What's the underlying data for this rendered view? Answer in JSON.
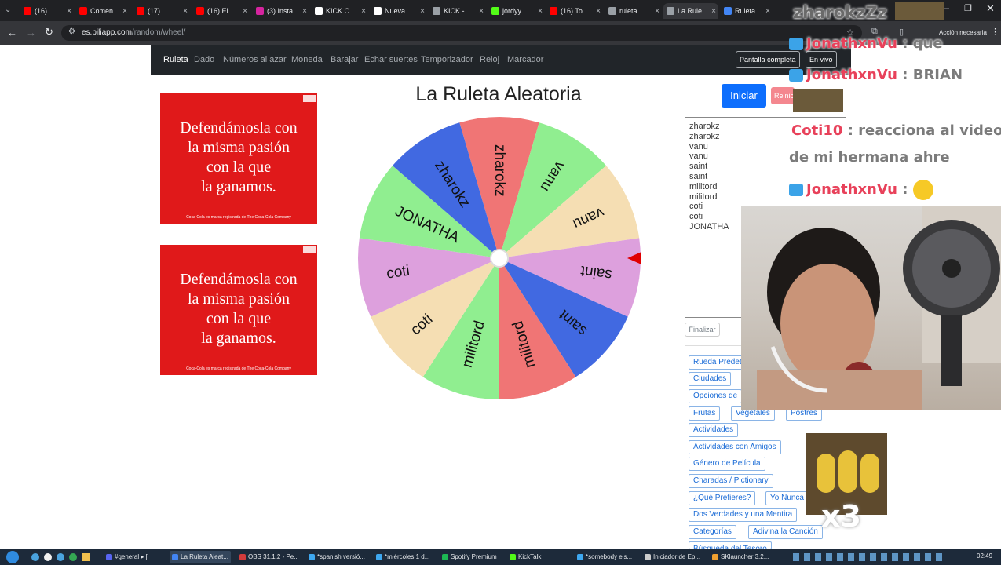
{
  "browser": {
    "tabs": [
      {
        "label": "(16)",
        "color": "#ff0000"
      },
      {
        "label": "Comen",
        "color": "#ff0000"
      },
      {
        "label": "(17)",
        "color": "#ff0000"
      },
      {
        "label": "(16) El",
        "color": "#ff0000"
      },
      {
        "label": "(3) Insta",
        "color": "#d6249f"
      },
      {
        "label": "KICK C",
        "color": "#ffffff"
      },
      {
        "label": "Nueva",
        "color": "#ffffff"
      },
      {
        "label": "KICK -",
        "color": "#9aa0a6"
      },
      {
        "label": "jordyy",
        "color": "#53fc18"
      },
      {
        "label": "(16) To",
        "color": "#ff0000"
      },
      {
        "label": "ruleta",
        "color": "#9aa0a6"
      },
      {
        "label": "La Rule",
        "color": "#9aa0a6"
      },
      {
        "label": "Ruleta",
        "color": "#4285f4"
      }
    ],
    "url_domain": "es.piliapp.com",
    "url_path": "/random/wheel/",
    "account_label": "Acción necesaria"
  },
  "nav": {
    "links": [
      "Ruleta",
      "Dado",
      "Números al azar",
      "Moneda",
      "Barajar",
      "Echar suertes",
      "Temporizador",
      "Reloj",
      "Marcador"
    ],
    "fullscreen_label": "Pantalla completa",
    "live_label": "En vivo"
  },
  "ads": {
    "text_line1": "Defendámosla con",
    "text_line2": "la misma pasión",
    "text_line3": "con la que",
    "text_line4": "la ganamos.",
    "footer": "Coca-Cola es marca registrada de The Coca-Cola Company"
  },
  "wheel": {
    "title": "La Ruleta Aleatoria",
    "start_label": "Iniciar",
    "reset_label": "Reinic",
    "finish_label": "Finalizar",
    "entries": [
      "zharokz",
      "zharokz",
      "vanu",
      "vanu",
      "saint",
      "saint",
      "militord",
      "militord",
      "coti",
      "coti",
      "JONATHA"
    ],
    "segments": [
      {
        "label": "zharokz",
        "color": "#f07575"
      },
      {
        "label": "vanu",
        "color": "#90ee90"
      },
      {
        "label": "vanu",
        "color": "#f5deb3"
      },
      {
        "label": "saint",
        "color": "#dda0dd"
      },
      {
        "label": "saint",
        "color": "#4169e1"
      },
      {
        "label": "militord",
        "color": "#f07575"
      },
      {
        "label": "militord",
        "color": "#90ee90"
      },
      {
        "label": "coti",
        "color": "#f5deb3"
      },
      {
        "label": "coti",
        "color": "#dda0dd"
      },
      {
        "label": "JONATHA",
        "color": "#90ee90"
      },
      {
        "label": "zharokz",
        "color": "#4169e1"
      }
    ],
    "pointer_color": "#e00000"
  },
  "presets": {
    "default_label": "Rueda Predet",
    "cities": "Ciudades",
    "options": "Opciones de",
    "fruits": "Frutas",
    "vegetables": "Vegetales",
    "desserts": "Postres",
    "activities": "Actividades",
    "activities_friends": "Actividades con Amigos",
    "movie_genre": "Género de Película",
    "charades": "Charadas / Pictionary",
    "would_you_rather": "¿Qué Prefieres?",
    "never": "Yo Nunca",
    "two_truths": "Dos Verdades y una Mentira",
    "categories": "Categorías",
    "guess_song": "Adivina la Canción",
    "hunt": "Búsqueda del Tesoro"
  },
  "stream": {
    "title": "zharokzZz",
    "chat": [
      {
        "user": "JonathxnVu",
        "msg": ": que"
      },
      {
        "user": "JonathxnVu",
        "msg": ": BRIAN"
      },
      {
        "user": "Coti10",
        "msg": ": reacciona al video"
      },
      {
        "user": "",
        "msg": "de mi hermana ahre"
      },
      {
        "user": "JonathxnVu",
        "msg": ":"
      }
    ],
    "gif_caption": "x3"
  },
  "taskbar": {
    "items": [
      {
        "label": "#general ▸ [",
        "color": "#5865f2"
      },
      {
        "label": "La Ruleta Aleat...",
        "color": "#4285f4"
      },
      {
        "label": "OBS 31.1.2 - Pe...",
        "color": "#d33b3b"
      },
      {
        "label": "*spanish versió...",
        "color": "#3ea8f0"
      },
      {
        "label": "*miércoles 1 d...",
        "color": "#3ea8f0"
      },
      {
        "label": "Spotify Premium",
        "color": "#1db954"
      },
      {
        "label": "KickTalk",
        "color": "#53fc18"
      },
      {
        "label": "*somebody els...",
        "color": "#3ea8f0"
      },
      {
        "label": "Iniciador de Ep...",
        "color": "#cccccc"
      },
      {
        "label": "SKlauncher 3.2...",
        "color": "#f0a030"
      }
    ],
    "clock": "02:49"
  }
}
